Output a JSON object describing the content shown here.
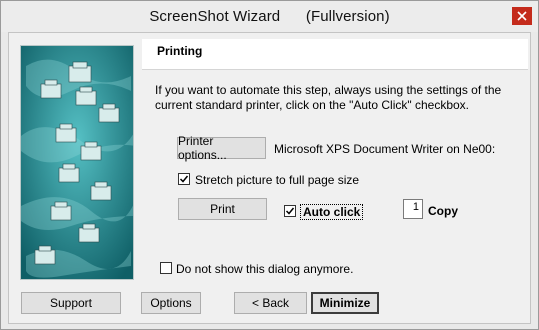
{
  "window": {
    "title": "ScreenShot Wizard      (Fullversion)",
    "close_icon": "close-icon"
  },
  "page": {
    "section_title": "Printing",
    "description": "If you want to automate this step, always using the settings of the current standard printer, click on the \"Auto Click\" checkbox."
  },
  "printer": {
    "options_button": "Printer options...",
    "printer_name": "Microsoft XPS Document Writer on Ne00:"
  },
  "stretch": {
    "checked": true,
    "label": "Stretch picture to full page size"
  },
  "print": {
    "button": "Print",
    "auto_click_checked": true,
    "auto_click_label": "Auto click",
    "copies_value": "1",
    "copies_label": "Copy"
  },
  "footer": {
    "dont_show_checked": false,
    "dont_show_label": "Do not show this dialog anymore.",
    "support_button": "Support",
    "options_button": "Options",
    "back_button": "< Back",
    "minimize_button": "Minimize"
  },
  "colors": {
    "close_button": "#c42b1c",
    "side_image": "#1e7f86"
  }
}
